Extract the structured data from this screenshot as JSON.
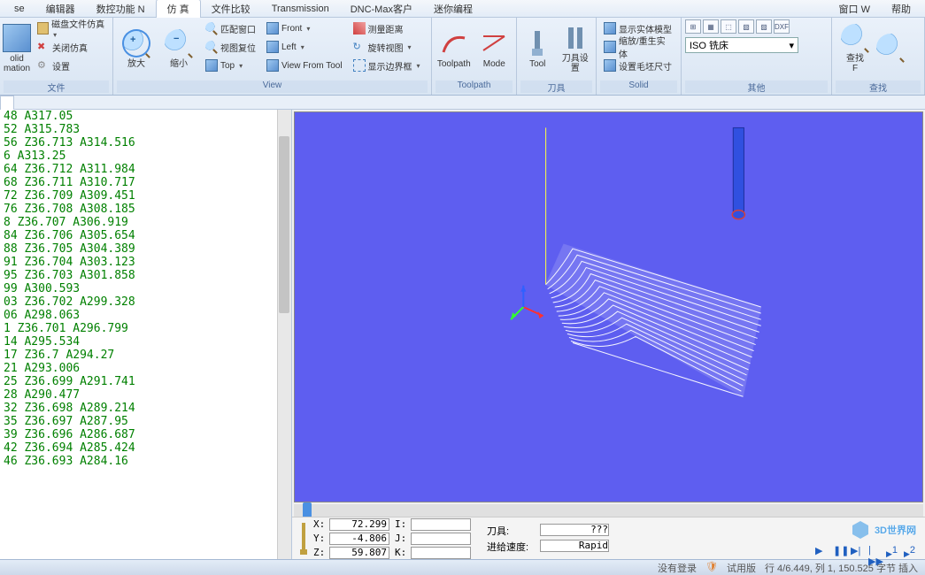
{
  "menu": {
    "items": [
      "se",
      "编辑器",
      "数控功能 N",
      "仿  真",
      "文件比较",
      "Transmission",
      "DNC-Max客户",
      "迷你编程"
    ],
    "active_index": 3,
    "right": [
      "窗口 W",
      "帮助"
    ]
  },
  "ribbon": {
    "g0": {
      "big": {
        "label1": "olid",
        "label2": "mation"
      },
      "small": [
        "磁盘文件仿真",
        "关闭仿真",
        "设置"
      ],
      "label": "文件"
    },
    "g_view": {
      "zoom_in": "放大",
      "zoom_out": "缩小",
      "col1": [
        "匹配窗口",
        "视图复位",
        "Top"
      ],
      "col2": [
        "Front",
        "Left",
        "View From Tool"
      ],
      "col3": [
        "测量距离",
        "旋转视图",
        "显示边界框"
      ],
      "label": "View"
    },
    "g_toolpath": {
      "big1": "Toolpath",
      "big2": "Mode",
      "label": "Toolpath"
    },
    "g_tool": {
      "big1": "Tool",
      "big2": "刀具设置",
      "label": "刀具"
    },
    "g_solid": {
      "items": [
        "显示实体模型",
        "缩放/重生实体",
        "设置毛坯尺寸"
      ],
      "label": "Solid"
    },
    "g_other": {
      "icons": [
        "⊞",
        "▦",
        "⬚",
        "▧",
        "▨",
        "DXF"
      ],
      "select": "ISO 铣床",
      "label": "其他"
    },
    "g_find": {
      "label1": "查找",
      "label2": "F",
      "label": "查找"
    }
  },
  "code": [
    "48 A317.05",
    "52 A315.783",
    "56 Z36.713 A314.516",
    "6 A313.25",
    "64 Z36.712 A311.984",
    "68 Z36.711 A310.717",
    "72 Z36.709 A309.451",
    "76 Z36.708 A308.185",
    "8 Z36.707 A306.919",
    "84 Z36.706 A305.654",
    "88 Z36.705 A304.389",
    "91 Z36.704 A303.123",
    "95 Z36.703 A301.858",
    "99 A300.593",
    "03 Z36.702 A299.328",
    "06 A298.063",
    "1 Z36.701 A296.799",
    "14 A295.534",
    "17 Z36.7 A294.27",
    "21 A293.006",
    "25 Z36.699 A291.741",
    "28 A290.477",
    "32 Z36.698 A289.214",
    "35 Z36.697 A287.95",
    "39 Z36.696 A286.687",
    "42 Z36.694 A285.424",
    "46 Z36.693 A284.16"
  ],
  "coords": {
    "X": "72.299",
    "Y": "-4.806",
    "Z": "59.807",
    "I": "",
    "J": "",
    "K": "",
    "tool_label": "刀具:",
    "tool_value": "???",
    "feed_label": "进给速度:",
    "feed_value": "Rapid"
  },
  "logo": "3D世界网",
  "statusbar": {
    "login": "没有登录",
    "trial": "试用版",
    "pos": "行 4/6.449, 列 1, 150.525 字节  插入"
  }
}
